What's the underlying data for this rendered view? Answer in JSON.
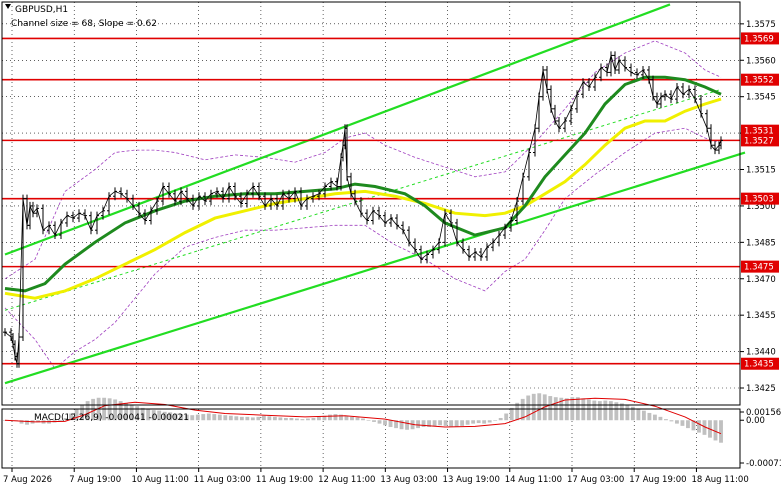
{
  "chart_data": {
    "type": "line",
    "header": {
      "symbol": "GBPUSD,H1",
      "channel_info": "Channel size = 68, Slope = 0.62"
    },
    "price_axis": {
      "ylim": [
        1.3418,
        1.3584
      ],
      "ticks": [
        "1.3575",
        "1.3560",
        "1.3545",
        "1.3530",
        "1.3515",
        "1.3500",
        "1.3485",
        "1.3470",
        "1.3455",
        "1.3440",
        "1.3425"
      ]
    },
    "level_lines": [
      {
        "label": "1.3569",
        "price": 1.3569
      },
      {
        "label": "1.3552",
        "price": 1.3552
      },
      {
        "label": "1.3527",
        "price": 1.3527
      },
      {
        "label": "1.3503",
        "price": 1.3503
      },
      {
        "label": "1.3475",
        "price": 1.3475
      },
      {
        "label": "1.3435",
        "price": 1.3435
      }
    ],
    "current_price_tag": {
      "label": "1.3531",
      "price": 1.3531
    },
    "time_labels": [
      "7 Aug 2026",
      "7 Aug 19:00",
      "10 Aug 11:00",
      "11 Aug 03:00",
      "11 Aug 19:00",
      "12 Aug 11:00",
      "13 Aug 03:00",
      "13 Aug 19:00",
      "14 Aug 11:00",
      "17 Aug 03:00",
      "17 Aug 19:00",
      "18 Aug 11:00"
    ],
    "price_series": {
      "name": "GBPUSD H1",
      "x": [
        0,
        6,
        8,
        10,
        12,
        14,
        18,
        22,
        25,
        28,
        32,
        38,
        44,
        50,
        56,
        62,
        68,
        74,
        80,
        86,
        92,
        98,
        104,
        110,
        116,
        122,
        128,
        134,
        140,
        146,
        152,
        158,
        164,
        170,
        176,
        182,
        188,
        194,
        200,
        206,
        212,
        218,
        224,
        230,
        236,
        242,
        248,
        254,
        260,
        266,
        272,
        278,
        284,
        290,
        296,
        302,
        308,
        314,
        320,
        326,
        332,
        336,
        338,
        340,
        342,
        346,
        350,
        356,
        362,
        368,
        374,
        380,
        386,
        392,
        398,
        404,
        410,
        416,
        422,
        428,
        434,
        440,
        446,
        452,
        458,
        464,
        470,
        476,
        482,
        488,
        494,
        500,
        506,
        512,
        518,
        524,
        530,
        534,
        538,
        542,
        546,
        550,
        554,
        560,
        566,
        572,
        578,
        584,
        590,
        596,
        602,
        606,
        610,
        614,
        620,
        626,
        632,
        638,
        644,
        648,
        652,
        656,
        660,
        666,
        672,
        678,
        684,
        690,
        696,
        702,
        706,
        710,
        714,
        716
      ],
      "y": [
        1.3448,
        1.3446,
        1.3443,
        1.3438,
        1.3435,
        1.3446,
        1.3503,
        1.3492,
        1.35,
        1.3497,
        1.3499,
        1.349,
        1.3492,
        1.3488,
        1.3493,
        1.3496,
        1.3495,
        1.3497,
        1.3496,
        1.349,
        1.3496,
        1.3498,
        1.3504,
        1.3506,
        1.3505,
        1.3503,
        1.35,
        1.3497,
        1.3494,
        1.3498,
        1.3502,
        1.3508,
        1.3505,
        1.3502,
        1.3506,
        1.3503,
        1.35,
        1.3504,
        1.3502,
        1.3505,
        1.3506,
        1.3503,
        1.3508,
        1.3504,
        1.3501,
        1.3505,
        1.3508,
        1.3504,
        1.35,
        1.3503,
        1.35,
        1.3505,
        1.3503,
        1.3506,
        1.35,
        1.3503,
        1.3504,
        1.3505,
        1.3508,
        1.351,
        1.3508,
        1.352,
        1.3525,
        1.3532,
        1.3512,
        1.3505,
        1.3502,
        1.3497,
        1.3494,
        1.3498,
        1.3496,
        1.3493,
        1.3495,
        1.3492,
        1.349,
        1.3485,
        1.3482,
        1.3478,
        1.348,
        1.3482,
        1.3485,
        1.3497,
        1.3493,
        1.3485,
        1.3482,
        1.3479,
        1.3481,
        1.3479,
        1.3483,
        1.3485,
        1.3488,
        1.3491,
        1.3494,
        1.3502,
        1.3512,
        1.3522,
        1.3532,
        1.3545,
        1.3556,
        1.3548,
        1.354,
        1.3535,
        1.3532,
        1.3535,
        1.354,
        1.3546,
        1.3551,
        1.3549,
        1.3553,
        1.3557,
        1.3555,
        1.3562,
        1.3556,
        1.356,
        1.3557,
        1.3555,
        1.3554,
        1.3556,
        1.3552,
        1.3545,
        1.3542,
        1.3545,
        1.3546,
        1.3544,
        1.3549,
        1.3546,
        1.3548,
        1.3544,
        1.3538,
        1.3532,
        1.3525,
        1.3523,
        1.3525,
        1.3527
      ]
    },
    "ma_fast": {
      "x": [
        0,
        20,
        40,
        60,
        90,
        120,
        150,
        180,
        210,
        240,
        270,
        300,
        330,
        350,
        370,
        400,
        420,
        440,
        470,
        500,
        520,
        540,
        560,
        580,
        600,
        620,
        640,
        660,
        680,
        700,
        716
      ],
      "y": [
        1.3466,
        1.3465,
        1.3468,
        1.3476,
        1.3485,
        1.3493,
        1.3498,
        1.3502,
        1.3504,
        1.3505,
        1.3505,
        1.3506,
        1.3507,
        1.3509,
        1.3508,
        1.3505,
        1.35,
        1.3493,
        1.3488,
        1.3491,
        1.35,
        1.3512,
        1.3521,
        1.353,
        1.3542,
        1.355,
        1.3553,
        1.3553,
        1.3552,
        1.3549,
        1.3546
      ]
    },
    "ma_slow": {
      "x": [
        0,
        30,
        60,
        90,
        120,
        150,
        180,
        210,
        240,
        270,
        300,
        330,
        360,
        390,
        420,
        450,
        480,
        500,
        520,
        540,
        560,
        580,
        600,
        620,
        640,
        660,
        680,
        700,
        716
      ],
      "y": [
        1.3464,
        1.3462,
        1.3465,
        1.347,
        1.3476,
        1.3482,
        1.3489,
        1.3495,
        1.3498,
        1.3501,
        1.3503,
        1.3505,
        1.3506,
        1.3504,
        1.3501,
        1.3497,
        1.3496,
        1.3497,
        1.35,
        1.3505,
        1.351,
        1.3517,
        1.3525,
        1.3532,
        1.3535,
        1.3535,
        1.3539,
        1.3542,
        1.3544
      ]
    },
    "bands_upper": {
      "x": [
        0,
        30,
        60,
        90,
        110,
        130,
        150,
        170,
        200,
        230,
        260,
        290,
        320,
        340,
        360,
        380,
        410,
        440,
        470,
        500,
        530,
        560,
        590,
        620,
        650,
        680,
        700,
        716
      ],
      "y": [
        1.347,
        1.3478,
        1.3506,
        1.3515,
        1.3522,
        1.3523,
        1.3523,
        1.3522,
        1.3519,
        1.3521,
        1.352,
        1.3518,
        1.3522,
        1.3528,
        1.353,
        1.3525,
        1.352,
        1.3516,
        1.3512,
        1.3514,
        1.3526,
        1.354,
        1.3555,
        1.3563,
        1.3568,
        1.3563,
        1.3556,
        1.3553
      ]
    },
    "bands_lower": {
      "x": [
        0,
        30,
        50,
        70,
        90,
        110,
        130,
        150,
        180,
        210,
        240,
        270,
        300,
        330,
        360,
        390,
        420,
        450,
        480,
        500,
        520,
        540,
        560,
        590,
        620,
        650,
        680,
        700,
        716
      ],
      "y": [
        1.3458,
        1.3445,
        1.3433,
        1.344,
        1.3445,
        1.3452,
        1.3462,
        1.3472,
        1.3483,
        1.3487,
        1.349,
        1.349,
        1.3491,
        1.3492,
        1.3492,
        1.3484,
        1.3478,
        1.347,
        1.3465,
        1.3473,
        1.3478,
        1.349,
        1.3503,
        1.3513,
        1.3522,
        1.353,
        1.3532,
        1.3528,
        1.3526
      ]
    },
    "channel": {
      "upper": [
        [
          0,
          1.348
        ],
        [
          665,
          1.3583
        ]
      ],
      "middle": [
        [
          0,
          1.3457
        ],
        [
          716,
          1.3548
        ]
      ],
      "lower": [
        [
          0,
          1.3427
        ],
        [
          740,
          1.3522
        ]
      ]
    },
    "macd": {
      "label": "MACD(12,26,9) -0.00041 -0.00021",
      "ylim": [
        -0.00085,
        0.0002
      ],
      "ticks": [
        "0.00156",
        "0.00",
        "-0.00071"
      ],
      "histogram": [
        0.0,
        0.0,
        0.0,
        -6e-05,
        -8e-05,
        -6e-05,
        -4e-05,
        -6e-05,
        -6e-05,
        -4e-05,
        -2e-05,
        4e-05,
        0.00012,
        0.0002,
        0.00028,
        0.00034,
        0.00038,
        0.0004,
        0.0004,
        0.00039,
        0.00037,
        0.00034,
        0.00031,
        0.00028,
        0.00025,
        0.00022,
        0.0002,
        0.00018,
        0.00017,
        0.00015,
        0.00014,
        0.00012,
        0.00011,
        0.0001,
        9e-05,
        0.0001,
        0.00011,
        0.00012,
        0.00011,
        0.0001,
        9e-05,
        8e-05,
        7e-05,
        6e-05,
        6e-05,
        5e-05,
        6e-05,
        8e-05,
        7e-05,
        6e-05,
        5e-05,
        4e-05,
        4e-05,
        3e-05,
        2e-05,
        3e-05,
        4e-05,
        6e-05,
        8e-05,
        0.0001,
        0.00011,
        0.0001,
        8e-05,
        6e-05,
        5e-05,
        3e-05,
        0.0,
        -3e-05,
        -6e-05,
        -9e-05,
        -0.00012,
        -0.00014,
        -0.00016,
        -0.00017,
        -0.00016,
        -0.00014,
        -0.00012,
        -0.00012,
        -0.00011,
        -9e-05,
        -0.0001,
        -0.00011,
        -0.00012,
        -0.0001,
        -8e-05,
        -6e-05,
        -5e-05,
        -6e-05,
        -4e-05,
        -1e-05,
        4e-05,
        0.00012,
        0.00022,
        0.00031,
        0.00038,
        0.00044,
        0.00047,
        0.00048,
        0.00046,
        0.00043,
        0.00041,
        0.0004,
        0.00039,
        0.00041,
        0.00041,
        0.00039,
        0.00037,
        0.00035,
        0.00034,
        0.00035,
        0.00034,
        0.00032,
        0.0003,
        0.00027,
        0.00024,
        0.00021,
        0.00017,
        0.00013,
        0.0001,
        6e-05,
        2e-05,
        -2e-05,
        -6e-05,
        -0.0001,
        -0.00014,
        -0.00018,
        -0.00022,
        -0.00026,
        -0.00031,
        -0.00036,
        -0.0004
      ],
      "signal": {
        "x": [
          0,
          30,
          60,
          80,
          100,
          130,
          160,
          190,
          220,
          260,
          300,
          340,
          380,
          410,
          440,
          470,
          500,
          520,
          540,
          560,
          590,
          620,
          650,
          680,
          700,
          716
        ],
        "y": [
          0.0,
          -3e-05,
          -2e-05,
          0.0001,
          0.00026,
          0.00032,
          0.00028,
          0.00018,
          0.00012,
          9e-05,
          6e-05,
          8e-05,
          2e-05,
          -8e-05,
          -0.00012,
          -0.00011,
          -6e-05,
          6e-05,
          0.00024,
          0.00036,
          0.00039,
          0.00037,
          0.00025,
          6e-05,
          -0.00012,
          -0.00024
        ]
      }
    },
    "colors": {
      "level": "#e00000",
      "level_tag": "#e00000",
      "channel": "#22dd22",
      "ma_fast": "#1e8a1e",
      "ma_slow": "#f0f000",
      "bands": "#a040c0",
      "grid": "#000000",
      "candle": "#000000",
      "macd_hist": "#c0c0c0",
      "macd_signal": "#e00000"
    }
  }
}
